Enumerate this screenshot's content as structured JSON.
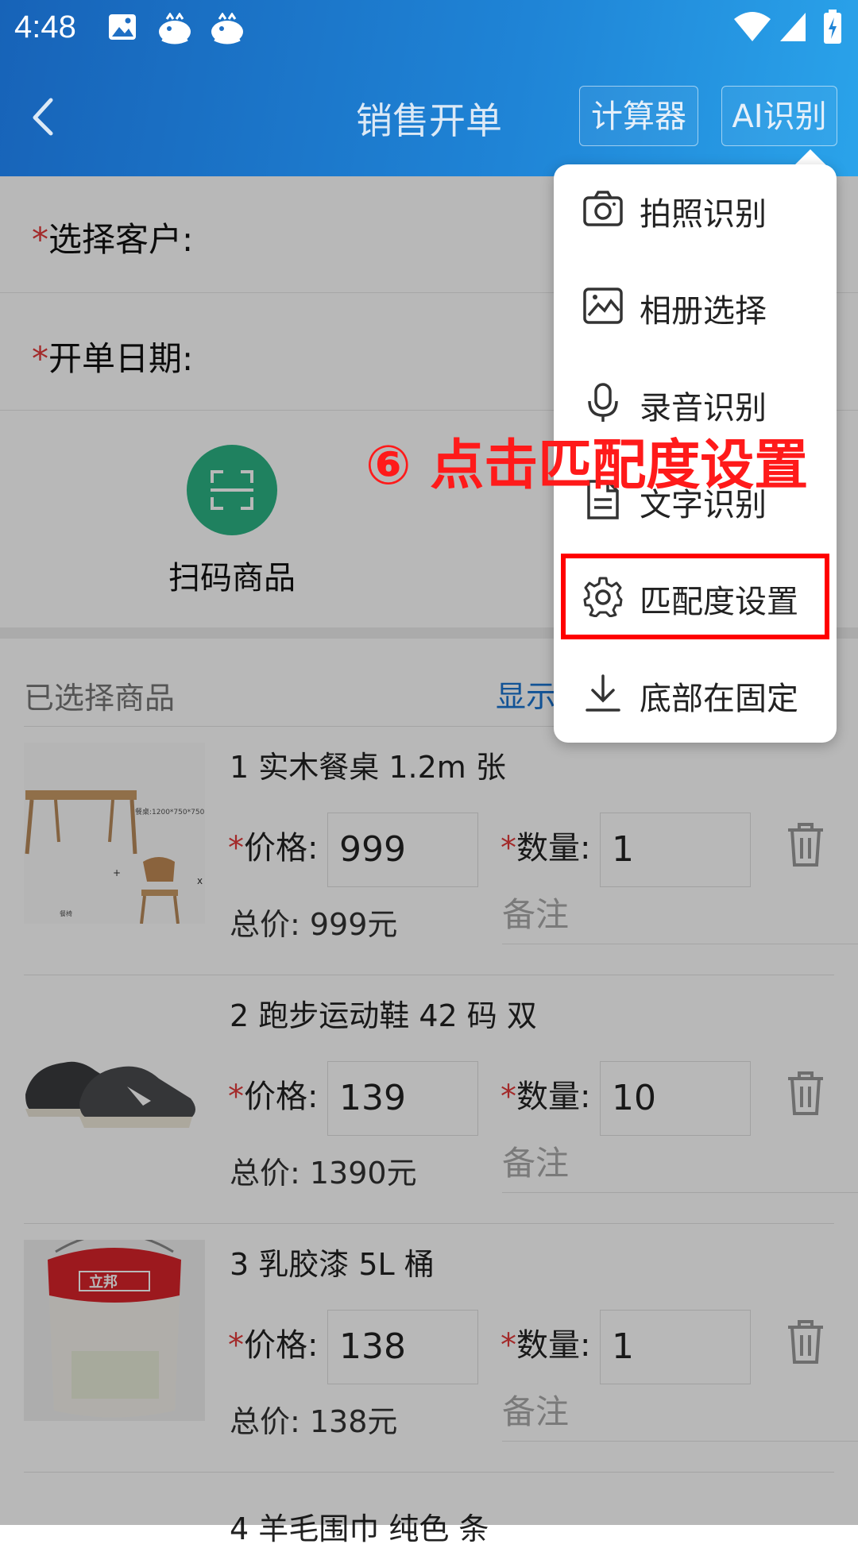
{
  "status_bar": {
    "time": "4:48"
  },
  "header": {
    "title": "销售开单",
    "calculator_label": "计算器",
    "ai_label": "AI识别"
  },
  "form": {
    "required_mark": "*",
    "customer_label": "选择客户:",
    "date_label": "开单日期:"
  },
  "scan": {
    "label": "扫码商品"
  },
  "selected": {
    "label": "已选择商品",
    "show_link": "显示"
  },
  "items": [
    {
      "name": "1 实木餐桌 1.2m 张",
      "price_label": "价格:",
      "price": "999",
      "qty_label": "数量:",
      "qty": "1",
      "total": "总价: 999元",
      "note": "备注",
      "img_caption": "餐桌:1200*750*750mm"
    },
    {
      "name": "2 跑步运动鞋 42 码 双",
      "price_label": "价格:",
      "price": "139",
      "qty_label": "数量:",
      "qty": "10",
      "total": "总价: 1390元",
      "note": "备注"
    },
    {
      "name": "3 乳胶漆 5L 桶",
      "price_label": "价格:",
      "price": "138",
      "qty_label": "数量:",
      "qty": "1",
      "total": "总价: 138元",
      "note": "备注",
      "img_brand": "立邦"
    },
    {
      "name": "4 羊毛围巾 纯色 条"
    }
  ],
  "menu": {
    "items": [
      {
        "label": "拍照识别",
        "icon": "camera-icon"
      },
      {
        "label": "相册选择",
        "icon": "image-icon"
      },
      {
        "label": "录音识别",
        "icon": "microphone-icon"
      },
      {
        "label": "文字识别",
        "icon": "document-icon"
      },
      {
        "label": "匹配度设置",
        "icon": "gear-icon"
      },
      {
        "label": "底部在固定",
        "icon": "download-icon"
      }
    ]
  },
  "annotation": {
    "text": "⑥ 点击匹配度设置",
    "color": "#ff1a1a"
  },
  "colors": {
    "accent": "#1f84d6",
    "scan_green": "#2bb384",
    "required": "#e23b3b",
    "link": "#1a73d0"
  }
}
